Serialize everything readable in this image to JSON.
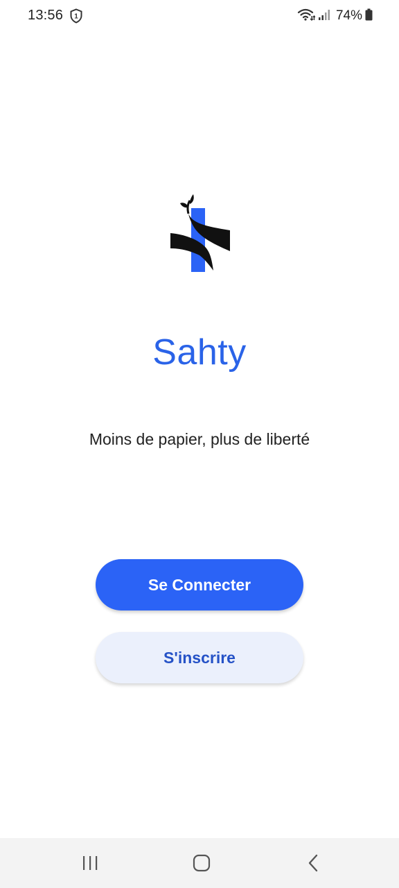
{
  "status_bar": {
    "time": "13:56",
    "battery": "74%",
    "icons": [
      "shield-icon",
      "wifi-icon",
      "signal-icon",
      "battery-icon"
    ]
  },
  "app": {
    "title": "Sahty",
    "tagline": "Moins de papier, plus de liberté",
    "logo": "sahty-logo",
    "colors": {
      "brand_blue": "#2b63f6",
      "title_blue": "#2a63e8",
      "secondary_bg": "#ebf0fc",
      "secondary_text": "#2552c7"
    }
  },
  "actions": {
    "login_label": "Se Connecter",
    "register_label": "S'inscrire"
  },
  "nav_bar": {
    "icons": [
      "recent-apps-icon",
      "home-icon",
      "back-icon"
    ]
  }
}
